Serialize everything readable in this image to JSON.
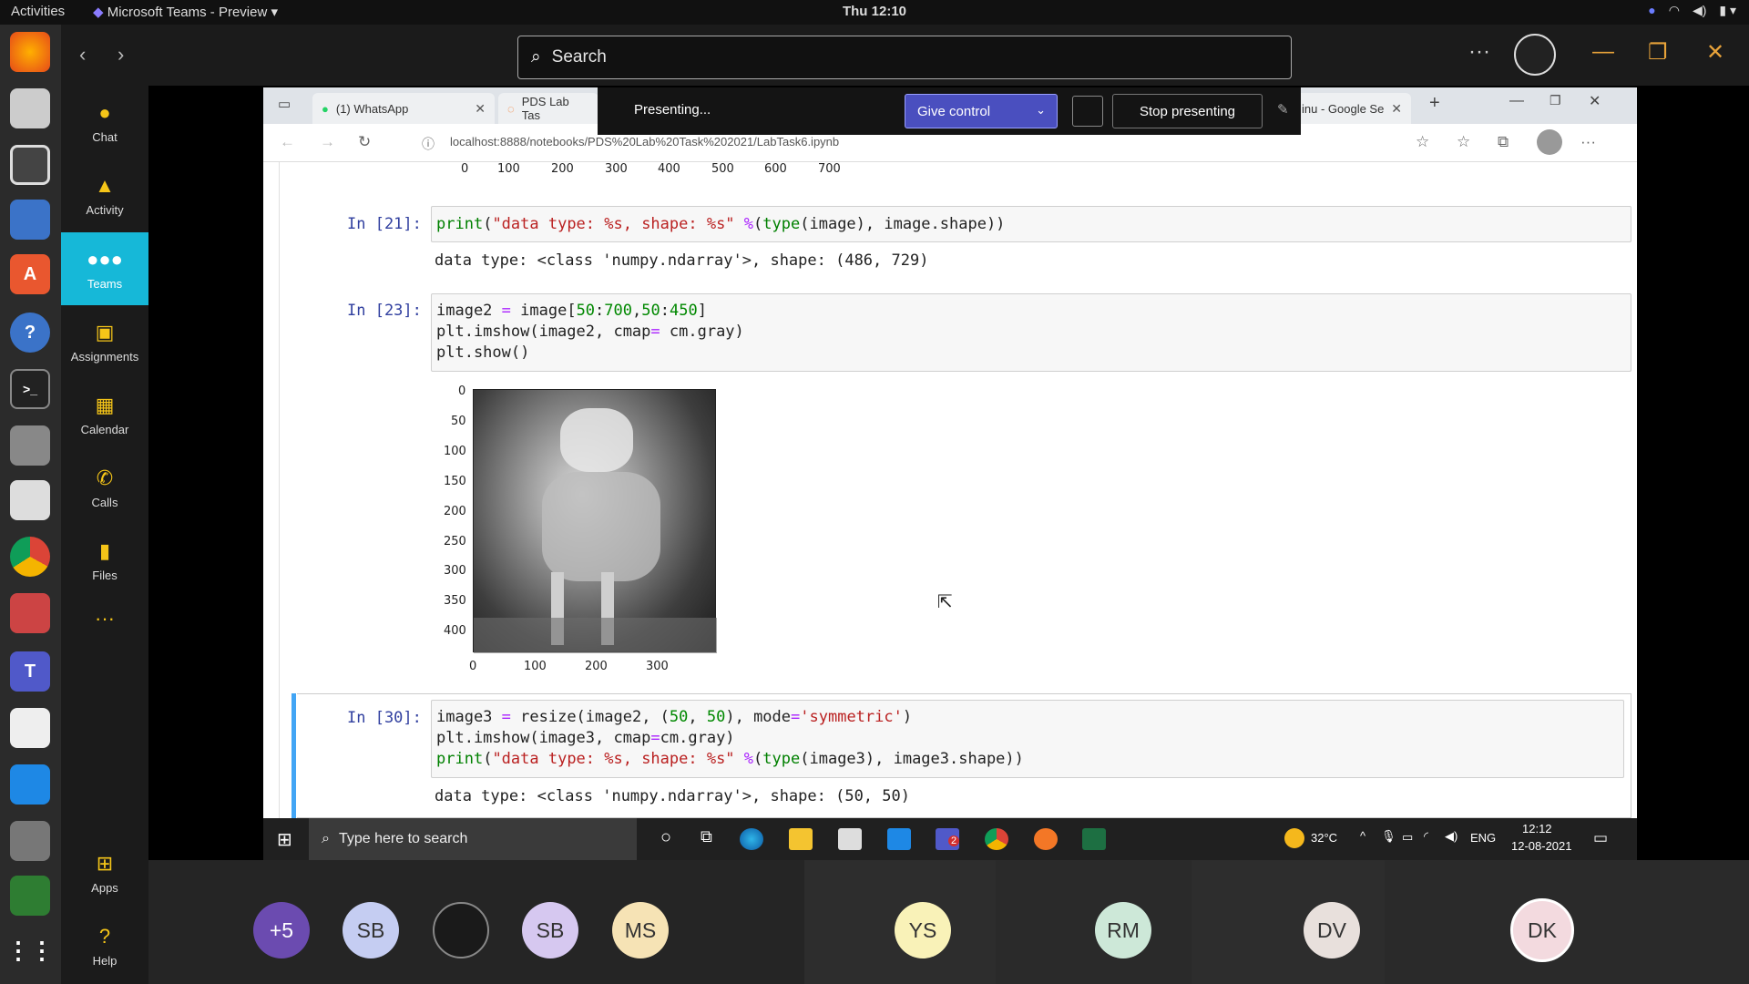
{
  "os_topbar": {
    "activities": "Activities",
    "app_title": "Microsoft Teams - Preview",
    "clock": "Thu 12:10"
  },
  "teams": {
    "search_placeholder": "Search",
    "rail": [
      {
        "label": "Chat",
        "icon": "chat-icon"
      },
      {
        "label": "Activity",
        "icon": "bell-icon"
      },
      {
        "label": "Teams",
        "icon": "teams-icon"
      },
      {
        "label": "Assignments",
        "icon": "assignments-icon"
      },
      {
        "label": "Calendar",
        "icon": "calendar-icon"
      },
      {
        "label": "Calls",
        "icon": "phone-icon"
      },
      {
        "label": "Files",
        "icon": "file-icon"
      },
      {
        "label": "Apps",
        "icon": "apps-icon"
      },
      {
        "label": "Help",
        "icon": "help-icon"
      }
    ],
    "more_label": "···",
    "header_more": "···"
  },
  "presenting_bar": {
    "status": "Presenting...",
    "give_control": "Give control",
    "stop_presenting": "Stop presenting"
  },
  "browser": {
    "tabs": [
      {
        "title": "(1) WhatsApp"
      },
      {
        "title": "PDS Lab Tas"
      },
      {
        "title": "inu - Google Se"
      }
    ],
    "url": "localhost:8888/notebooks/PDS%20Lab%20Task%202021/LabTask6.ipynb"
  },
  "notebook": {
    "top_axis_ticks": [
      "0",
      "100",
      "200",
      "300",
      "400",
      "500",
      "600",
      "700"
    ],
    "cells": [
      {
        "prompt": "In [21]:",
        "code": [
          "print(\"data type: %s, shape: %s\" %(type(image), image.shape))"
        ],
        "output": "data type: <class 'numpy.ndarray'>, shape: (486, 729)"
      },
      {
        "prompt": "In [23]:",
        "code": [
          "image2 = image[50:700,50:450]",
          "plt.imshow(image2, cmap= cm.gray)",
          "plt.show()"
        ],
        "plot": {
          "y_ticks": [
            "0",
            "50",
            "100",
            "150",
            "200",
            "250",
            "300",
            "350",
            "400"
          ],
          "x_ticks": [
            "0",
            "100",
            "200",
            "300"
          ]
        }
      },
      {
        "prompt": "In [30]:",
        "code": [
          "image3 = resize(image2, (50, 50), mode='symmetric')",
          "plt.imshow(image3, cmap=cm.gray)",
          "print(\"data type: %s, shape: %s\" %(type(image3), image3.shape))"
        ],
        "output": "data type: <class 'numpy.ndarray'>, shape: (50, 50)"
      }
    ]
  },
  "windows_taskbar": {
    "search_placeholder": "Type here to search",
    "weather": "32°C",
    "lang": "ENG",
    "time": "12:12",
    "date": "12-08-2021",
    "teams_badge": "2"
  },
  "participants": [
    {
      "initials": "+5",
      "color": "#6b4bb0"
    },
    {
      "initials": "SB",
      "color": "#c5cdf2"
    },
    {
      "initials": "",
      "color": "#1a1a1a"
    },
    {
      "initials": "SB",
      "color": "#d6c8f0"
    },
    {
      "initials": "MS",
      "color": "#f6e3b5"
    },
    {
      "initials": "YS",
      "color": "#f9f2b8"
    },
    {
      "initials": "RM",
      "color": "#cde8d8"
    },
    {
      "initials": "DV",
      "color": "#e8e0dc"
    },
    {
      "initials": "DK",
      "color": "#f3dadf"
    }
  ]
}
